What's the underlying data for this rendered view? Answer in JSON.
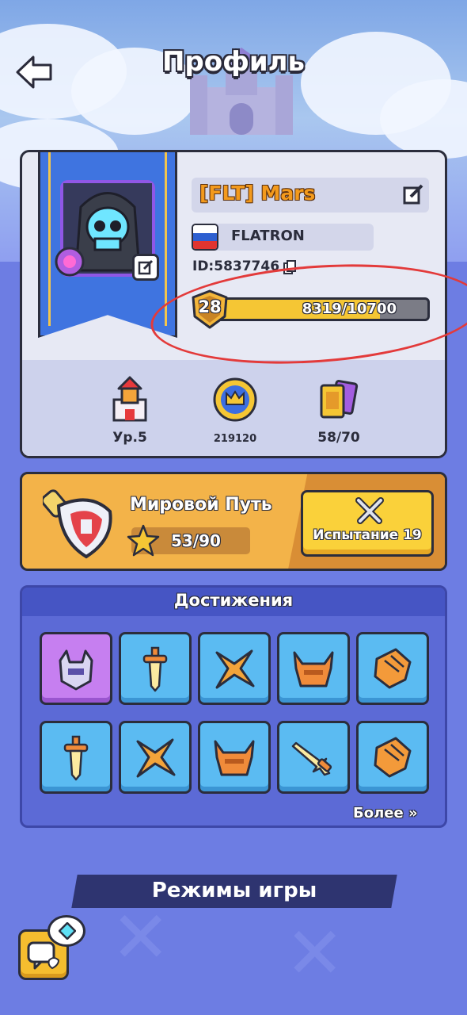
{
  "header": {
    "title": "Профиль"
  },
  "profile": {
    "name": "[FLT] Mars",
    "clan": "FLATRON",
    "id_text": "ID:5837746",
    "level": "28",
    "xp_text": "8319/10700",
    "xp_fraction": 0.777
  },
  "stats": [
    {
      "label": "Ур.5",
      "icon": "castle-icon"
    },
    {
      "label": "219120",
      "icon": "crown-medal-icon"
    },
    {
      "label": "58/70",
      "icon": "cards-icon"
    }
  ],
  "world_path": {
    "title": "Мировой Путь",
    "progress": "53/90",
    "trial_label": "Испытание 19"
  },
  "achievements": {
    "title": "Достижения",
    "more_label": "Более",
    "tiles": [
      "dragon-helmet-icon",
      "sword-icon",
      "shuriken-icon",
      "horned-helmet-icon",
      "fist-icon",
      "sword-icon",
      "shuriken-icon",
      "horned-helmet-icon",
      "dagger-icon",
      "fist-icon"
    ]
  },
  "modes": {
    "title": "Режимы игры"
  },
  "colors": {
    "accent_orange": "#f39a1c",
    "button_yellow": "#fad13a",
    "background_blue": "#6f7ee0",
    "marker_red": "#e33a3a"
  }
}
